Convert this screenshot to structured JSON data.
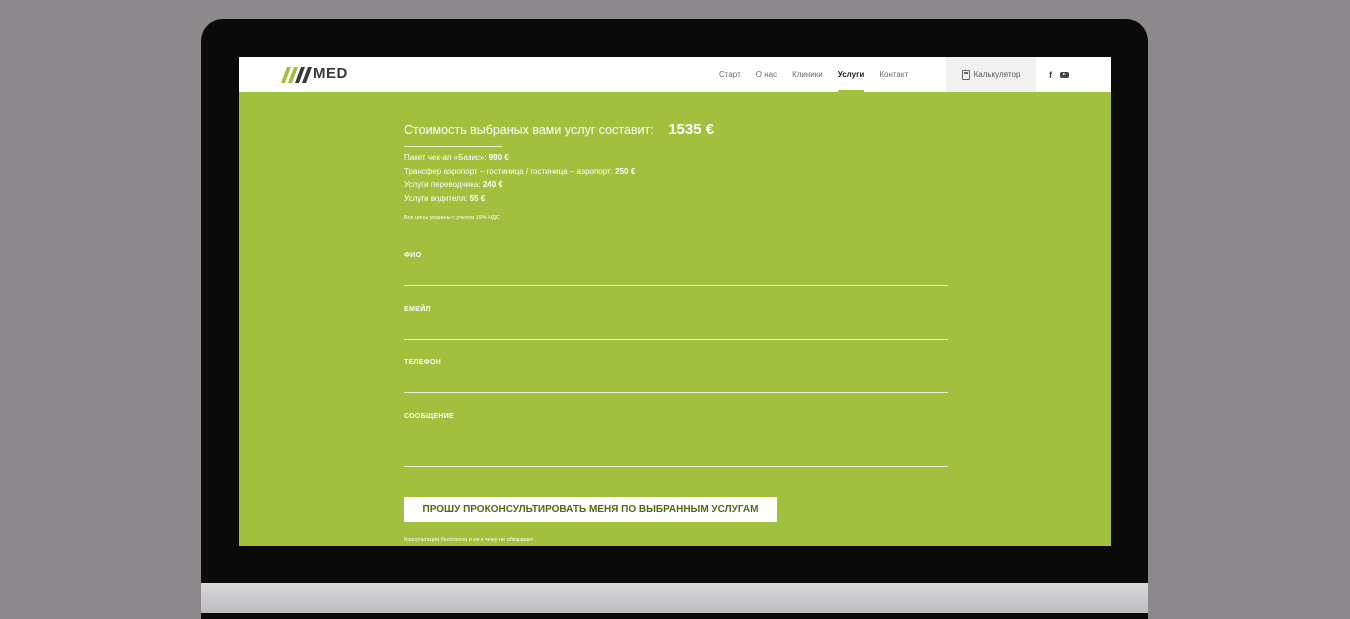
{
  "brand": {
    "logo_text": "MED"
  },
  "nav": {
    "items": [
      {
        "label": "Старт",
        "active": false
      },
      {
        "label": "О нас",
        "active": false
      },
      {
        "label": "Клиники",
        "active": false
      },
      {
        "label": "Услуги",
        "active": true
      },
      {
        "label": "Контакт",
        "active": false
      }
    ],
    "calculator_label": "Калькулятор",
    "social_icons": [
      "facebook-icon",
      "youtube-icon"
    ]
  },
  "summary": {
    "total_label": "Стоимость выбраных вами услуг составит:",
    "total_value": "1535 €",
    "items": [
      {
        "label": "Пакет чек-ап «Базис»: ",
        "value": "990 €"
      },
      {
        "label": "Трансфер аэропорт – гостиница / гостиница – аэропорт: ",
        "value": "250 €"
      },
      {
        "label": "Услуги переводчика: ",
        "value": "240 €"
      },
      {
        "label": "Услуги водителя: ",
        "value": "55 €"
      }
    ],
    "vat_note": "Все цены указаны с учетом 19% НДС"
  },
  "form": {
    "fields": [
      {
        "label": "ФИО"
      },
      {
        "label": "ЕМЕЙЛ"
      },
      {
        "label": "ТЕЛЕФОН"
      },
      {
        "label": "СООБЩЕНИЕ"
      }
    ],
    "submit_label": "ПРОШУ ПРОКОНСУЛЬТИРОВАТЬ МЕНЯ ПО ВЫБРАННЫМ УСЛУГАМ",
    "note": "Консультация бесплатна и ни к чему не обязывает"
  },
  "colors": {
    "brand_green": "#a0c03e",
    "page_bg": "#8c888b",
    "monitor_bezel": "#0a0a0a"
  }
}
